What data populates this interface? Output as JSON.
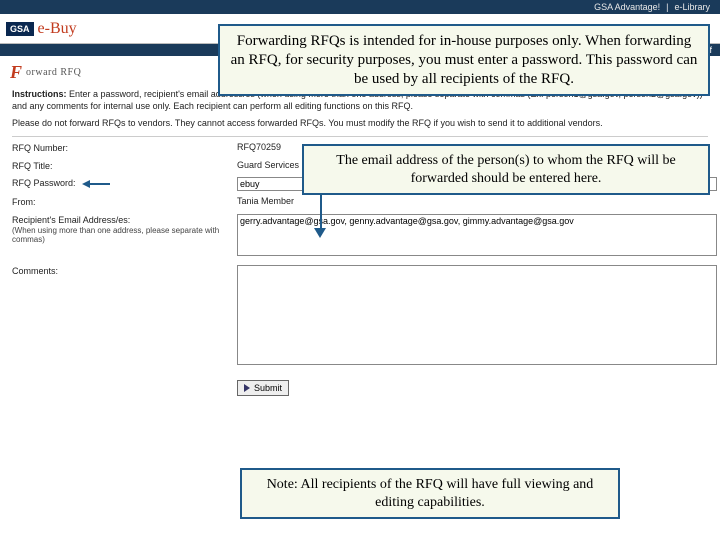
{
  "topnav": {
    "advantage": "GSA Advantage!",
    "sep": "|",
    "elibrary": "e-Library"
  },
  "header": {
    "gsa": "GSA",
    "ebuy": "e-Buy",
    "off": "off"
  },
  "page": {
    "logo_letter": "F",
    "title": "orward RFQ",
    "instructions_label": "Instructions:",
    "instructions_text": " Enter a password, recipient's email address/es (when using more than one address, please separate with commas (Ex. person1@gsa.gov, person2@gsa.gov)) and any comments for internal use only. Each recipient can perform all editing functions on this RFQ.",
    "warning": "Please do not forward RFQs to vendors. They cannot access forwarded RFQs. You must modify the RFQ if you wish to send it to additional vendors."
  },
  "form": {
    "rfq_number_label": "RFQ Number:",
    "rfq_number_value": "RFQ70259",
    "rfq_title_label": "RFQ Title:",
    "rfq_title_value": "Guard Services",
    "rfq_password_label": "RFQ Password:",
    "rfq_password_value": "ebuy",
    "from_label": "From:",
    "from_value": "Tania Member",
    "recipients_label": "Recipient's Email Address/es:",
    "recipients_sub": "(When using more than one address, please separate with commas)",
    "recipients_value": "gerry.advantage@gsa.gov, genny.advantage@gsa.gov, gimmy.advantage@gsa.gov",
    "comments_label": "Comments:",
    "comments_value": "",
    "submit_label": "Submit"
  },
  "callouts": {
    "c1": "Forwarding RFQs is intended for in-house purposes only. When forwarding an RFQ, for security purposes, you must enter a password. This password can be used by all recipients of the RFQ.",
    "c2": "The email address of the person(s) to whom the RFQ will be forwarded should be entered here.",
    "c3": "Note: All recipients of the RFQ will have full viewing and editing capabilities."
  }
}
